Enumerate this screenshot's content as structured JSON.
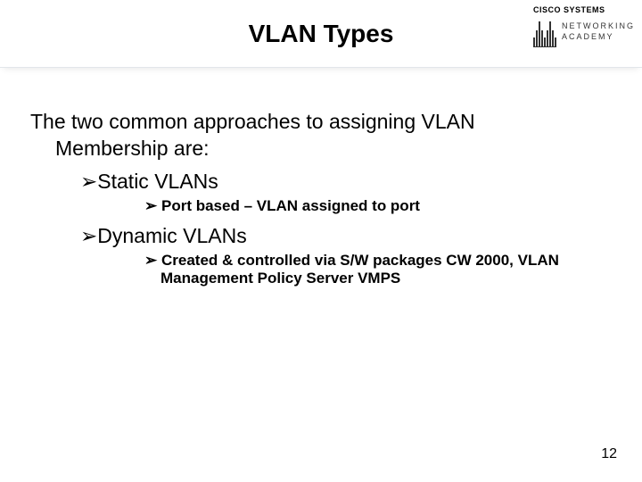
{
  "slide": {
    "title": "VLAN Types",
    "page_number": "12"
  },
  "logo": {
    "brand_top": "CISCO SYSTEMS",
    "brand_line1": "NETWORKING",
    "brand_line2": "ACADEMY"
  },
  "content": {
    "intro_line1": "The two common approaches to assigning VLAN",
    "intro_line2": "Membership are:",
    "items": [
      {
        "label": "Static VLANs",
        "sub": "Port based – VLAN assigned to port",
        "sub_cont": ""
      },
      {
        "label": "Dynamic VLANs",
        "sub": "Created & controlled via S/W packages CW 2000, VLAN",
        "sub_cont": "Management Policy Server VMPS"
      }
    ]
  },
  "glyphs": {
    "arrow": "➢"
  }
}
